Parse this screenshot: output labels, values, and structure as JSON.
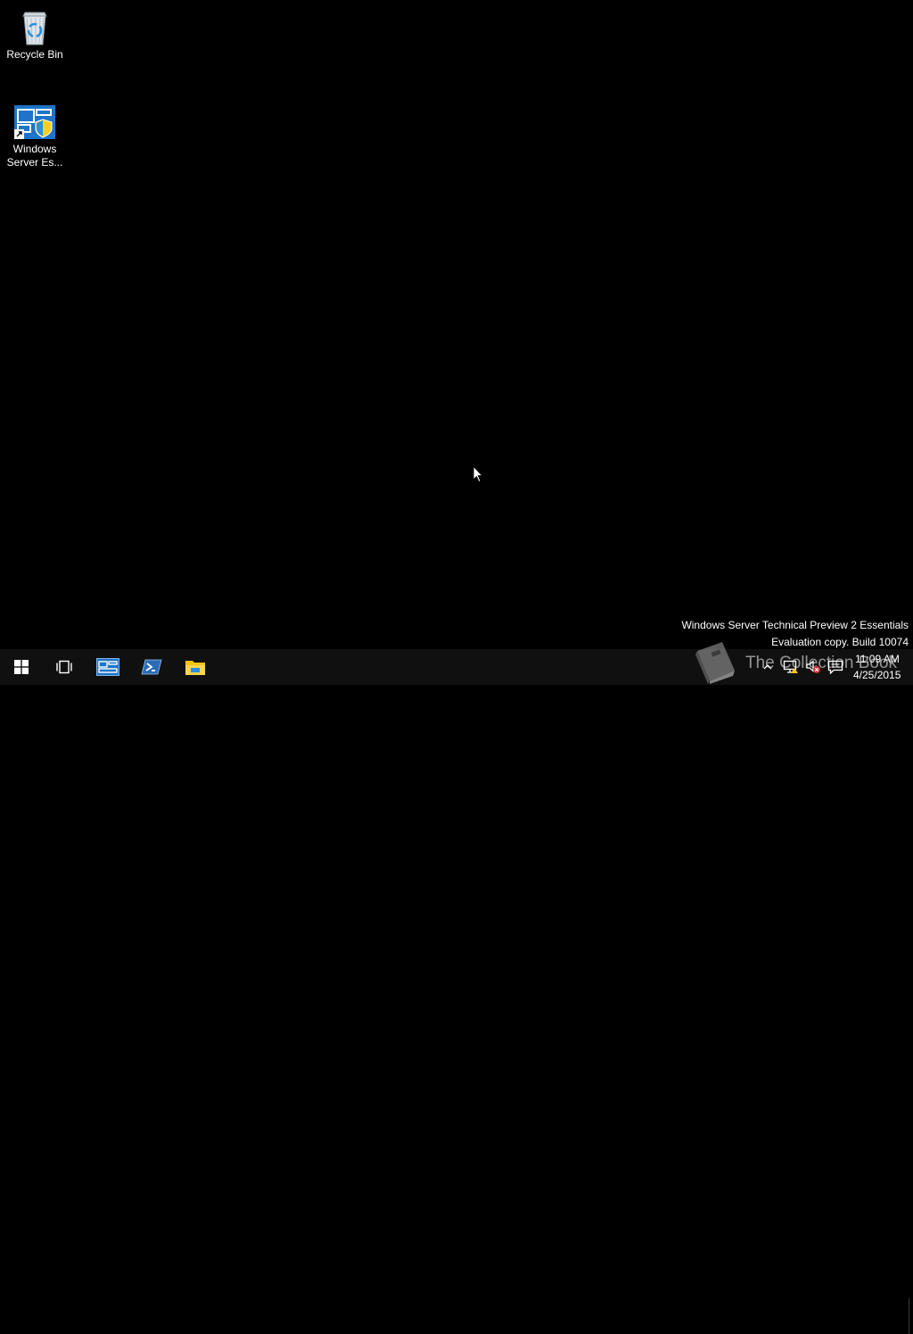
{
  "desktop": {
    "icons": [
      {
        "label": "Recycle Bin",
        "icon": "recycle-bin-icon"
      },
      {
        "label": "Windows\nServer Es...",
        "icon": "windows-server-essentials-icon"
      }
    ],
    "watermark": {
      "line1": "Windows Server Technical Preview 2 Essentials",
      "line2": "Evaluation copy. Build 10074"
    },
    "overlay_text": "The Collection Book"
  },
  "taskbar": {
    "pinned": [
      {
        "name": "start",
        "icon": "windows-logo-icon"
      },
      {
        "name": "task-view",
        "icon": "task-view-icon"
      },
      {
        "name": "wse-dashboard",
        "icon": "dashboard-icon"
      },
      {
        "name": "powershell",
        "icon": "powershell-icon"
      },
      {
        "name": "file-explorer",
        "icon": "folder-icon"
      }
    ],
    "tray": {
      "icons": [
        "chevron-up-icon",
        "network-icon",
        "volume-muted-icon",
        "action-center-icon"
      ],
      "time": "11:09 AM",
      "date": "4/25/2015"
    }
  },
  "colors": {
    "desktop_bg": "#000000",
    "taskbar_bg": "#101010",
    "accent_blue": "#1e74c8",
    "folder_yellow": "#f5c518",
    "powershell_blue": "#2a6cb8"
  }
}
